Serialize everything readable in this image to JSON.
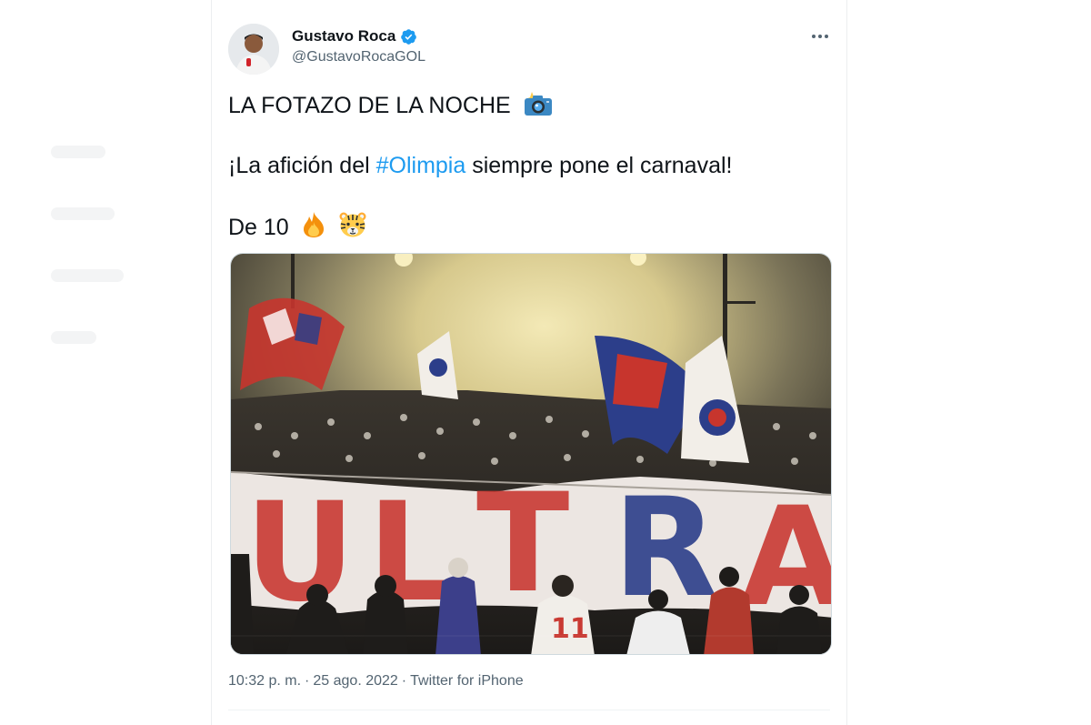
{
  "tweet": {
    "author_name": "Gustavo Roca",
    "author_handle": "@GustavoRocaGOL",
    "line1": "LA FOTAZO DE LA NOCHE",
    "line2_prefix": "¡La afición del ",
    "hashtag": "#Olimpia",
    "line2_suffix": " siempre pone el carnaval!",
    "line3": "De 10",
    "emoji": {
      "line1": "camera-flash-icon",
      "line3": [
        "fire-icon",
        "tiger-face-icon"
      ]
    },
    "time": "10:32 p. m.",
    "separator": "·",
    "date": "25 ago. 2022",
    "source": "Twitter for iPhone",
    "banner_letters": [
      "U",
      "L",
      "T",
      "R",
      "A"
    ],
    "fan_shirt_number": "11"
  },
  "colors": {
    "link": "#1d9bf0",
    "secondary_text": "#536471",
    "verified": "#1d9bf0"
  }
}
